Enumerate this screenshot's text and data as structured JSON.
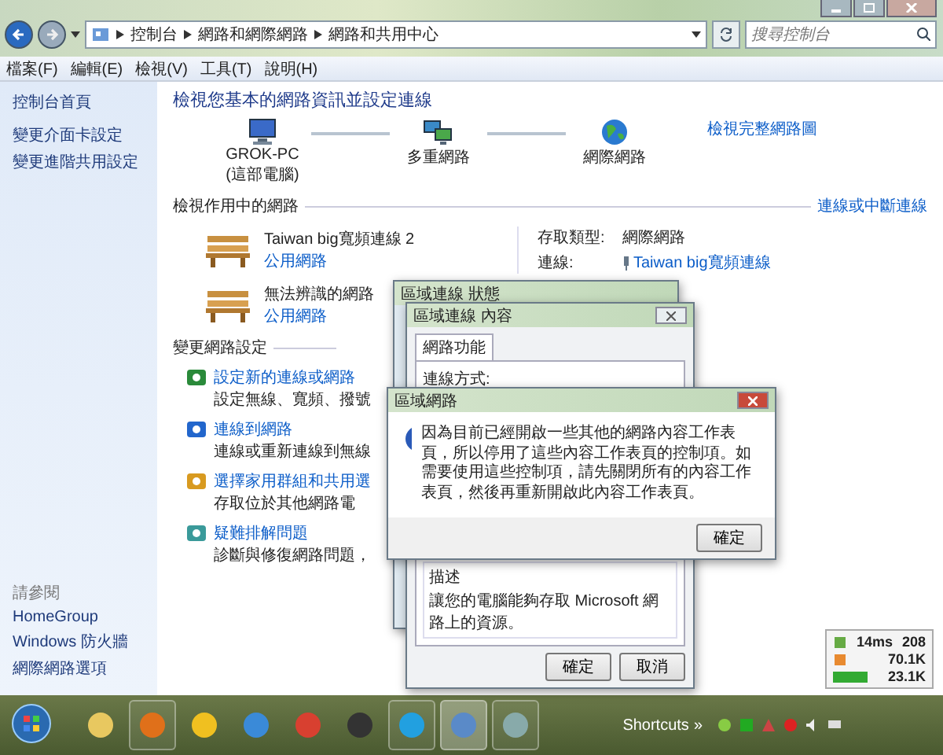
{
  "address_bar": {
    "crumbs": [
      "控制台",
      "網路和網際網路",
      "網路和共用中心"
    ],
    "search_placeholder": "搜尋控制台"
  },
  "menu": [
    "檔案(F)",
    "編輯(E)",
    "檢視(V)",
    "工具(T)",
    "說明(H)"
  ],
  "sidebar": {
    "items": [
      "控制台首頁",
      "變更介面卡設定",
      "變更進階共用設定"
    ],
    "see_also_heading": "請參閱",
    "see_also": [
      "HomeGroup",
      "Windows 防火牆",
      "網際網路選項"
    ]
  },
  "main": {
    "title": "檢視您基本的網路資訊並設定連線",
    "map_link": "檢視完整網路圖",
    "map_nodes": [
      {
        "kind": "computer",
        "label": "GROK-PC",
        "sublabel": "(這部電腦)"
      },
      {
        "kind": "network",
        "label": "多重網路"
      },
      {
        "kind": "internet",
        "label": "網際網路"
      }
    ],
    "active_heading": "檢視作用中的網路",
    "connect_link": "連線或中斷連線",
    "networks": [
      {
        "name": "Taiwan big寬頻連線 2",
        "type": "公用網路",
        "access_label": "存取類型:",
        "access": "網際網路",
        "connection_label": "連線:",
        "connection": "Taiwan big寬頻連線"
      },
      {
        "name": "無法辨識的網路",
        "type": "公用網路"
      }
    ],
    "settings_heading": "變更網路設定",
    "tasks": [
      {
        "kind": "new-connection",
        "title": "設定新的連線或網路",
        "desc": "設定無線、寬頻、撥號"
      },
      {
        "kind": "connect",
        "title": "連線到網路",
        "desc": "連線或重新連線到無線"
      },
      {
        "kind": "homegroup",
        "title": "選擇家用群組和共用選",
        "desc": "存取位於其他網路電"
      },
      {
        "kind": "troubleshoot",
        "title": "疑難排解問題",
        "desc": "診斷與修復網路問題，"
      }
    ]
  },
  "dialogs": {
    "status": {
      "title": "區域連線 狀態"
    },
    "properties": {
      "title": "區域連線 內容",
      "tabs": [
        {
          "label": "網路功能",
          "selected": true
        }
      ],
      "connect_using_label": "連線方式:",
      "description_heading": "描述",
      "description": "讓您的電腦能夠存取 Microsoft 網路上的資源。",
      "buttons": [
        "確定",
        "取消"
      ]
    },
    "message": {
      "title": "區域網路",
      "text": "因為目前已經開啟一些其他的網路內容工作表頁，所以停用了這些內容工作表頁的控制項。如需要使用這些控制項，請先關閉所有的內容工作表頁，然後再重新開啟此內容工作表頁。",
      "button": "確定"
    }
  },
  "gadget": {
    "ping": "14ms",
    "ping_count": "208",
    "download": "70.1K",
    "upload": "23.1K"
  },
  "taskbar": {
    "apps": [
      {
        "kind": "folder",
        "running": false,
        "selected": false
      },
      {
        "kind": "firefox",
        "running": true,
        "selected": false
      },
      {
        "kind": "tag-app",
        "running": false,
        "selected": false
      },
      {
        "kind": "ie",
        "running": false,
        "selected": false
      },
      {
        "kind": "chrome",
        "running": false,
        "selected": false
      },
      {
        "kind": "alien-app",
        "running": false,
        "selected": false
      },
      {
        "kind": "skype",
        "running": true,
        "selected": false
      },
      {
        "kind": "network",
        "running": true,
        "selected": true
      },
      {
        "kind": "media",
        "running": true,
        "selected": false
      }
    ],
    "shortcuts_label": "Shortcuts",
    "shortcuts_more": "»"
  }
}
